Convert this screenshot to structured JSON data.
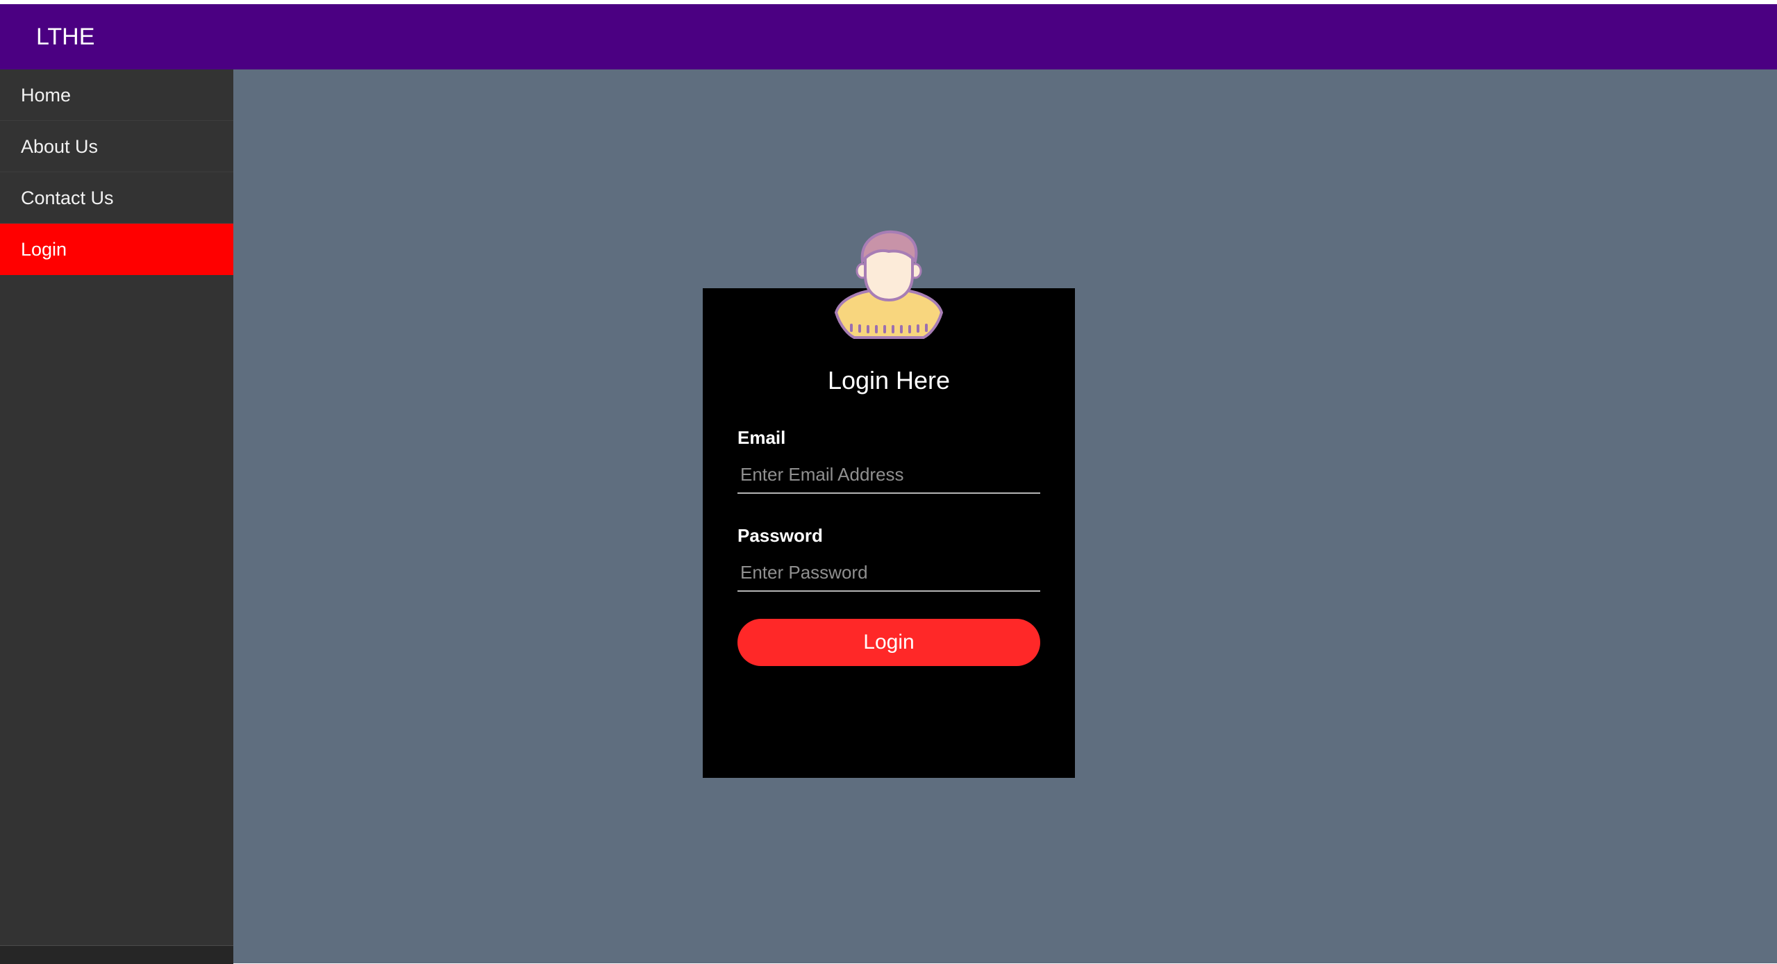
{
  "header": {
    "brand": "LTHE"
  },
  "sidebar": {
    "items": [
      {
        "label": "Home"
      },
      {
        "label": "About Us"
      },
      {
        "label": "Contact Us"
      },
      {
        "label": "Login",
        "active": true
      }
    ]
  },
  "login_form": {
    "avatar_icon": "user-avatar-icon",
    "title": "Login Here",
    "email_label": "Email",
    "email_placeholder": "Enter Email Address",
    "email_value": "",
    "password_label": "Password",
    "password_placeholder": "Enter Password",
    "password_value": "",
    "submit_label": "Login"
  },
  "colors": {
    "header": "#4b0082",
    "sidebar": "#333333",
    "active_nav": "#ff0000",
    "main_background": "#5f6e7f",
    "card": "#000000",
    "button": "#ff2828"
  }
}
